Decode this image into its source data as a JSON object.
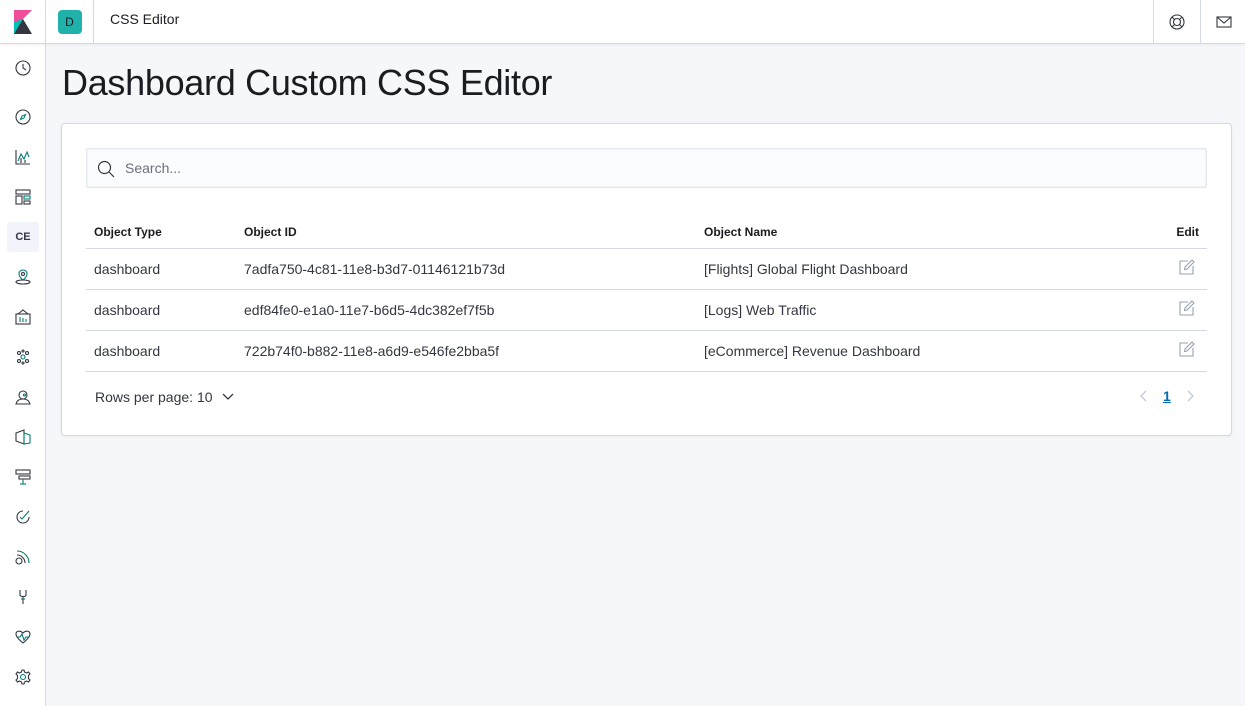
{
  "header": {
    "space_initial": "D",
    "app_title": "CSS Editor"
  },
  "sidenav": {
    "items": [
      {
        "icon": "clock-icon"
      },
      {
        "icon": "compass-icon"
      },
      {
        "icon": "visualize-icon"
      },
      {
        "icon": "dashboard-icon"
      },
      {
        "label": "CE"
      },
      {
        "icon": "maps-icon"
      },
      {
        "icon": "canvas-icon"
      },
      {
        "icon": "ml-icon"
      },
      {
        "icon": "user-icon"
      },
      {
        "icon": "apm-icon"
      },
      {
        "icon": "logs-icon"
      },
      {
        "icon": "uptime-icon"
      },
      {
        "icon": "siem-icon"
      },
      {
        "icon": "dev-tools-icon"
      },
      {
        "icon": "monitoring-icon"
      },
      {
        "icon": "gear-icon"
      }
    ]
  },
  "page": {
    "title": "Dashboard Custom CSS Editor"
  },
  "search": {
    "placeholder": "Search..."
  },
  "table": {
    "columns": [
      "Object Type",
      "Object ID",
      "Object Name",
      "Edit"
    ],
    "rows": [
      {
        "type": "dashboard",
        "id": "7adfa750-4c81-11e8-b3d7-01146121b73d",
        "name": "[Flights] Global Flight Dashboard"
      },
      {
        "type": "dashboard",
        "id": "edf84fe0-e1a0-11e7-b6d5-4dc382ef7f5b",
        "name": "[Logs] Web Traffic"
      },
      {
        "type": "dashboard",
        "id": "722b74f0-b882-11e8-a6d9-e546fe2bba5f",
        "name": "[eCommerce] Revenue Dashboard"
      }
    ]
  },
  "pagination": {
    "rows_per_page": "Rows per page: 10",
    "current_page": "1"
  },
  "colors": {
    "accent": "#017d73",
    "link": "#006bb8",
    "space_avatar": "#20b2aa"
  }
}
